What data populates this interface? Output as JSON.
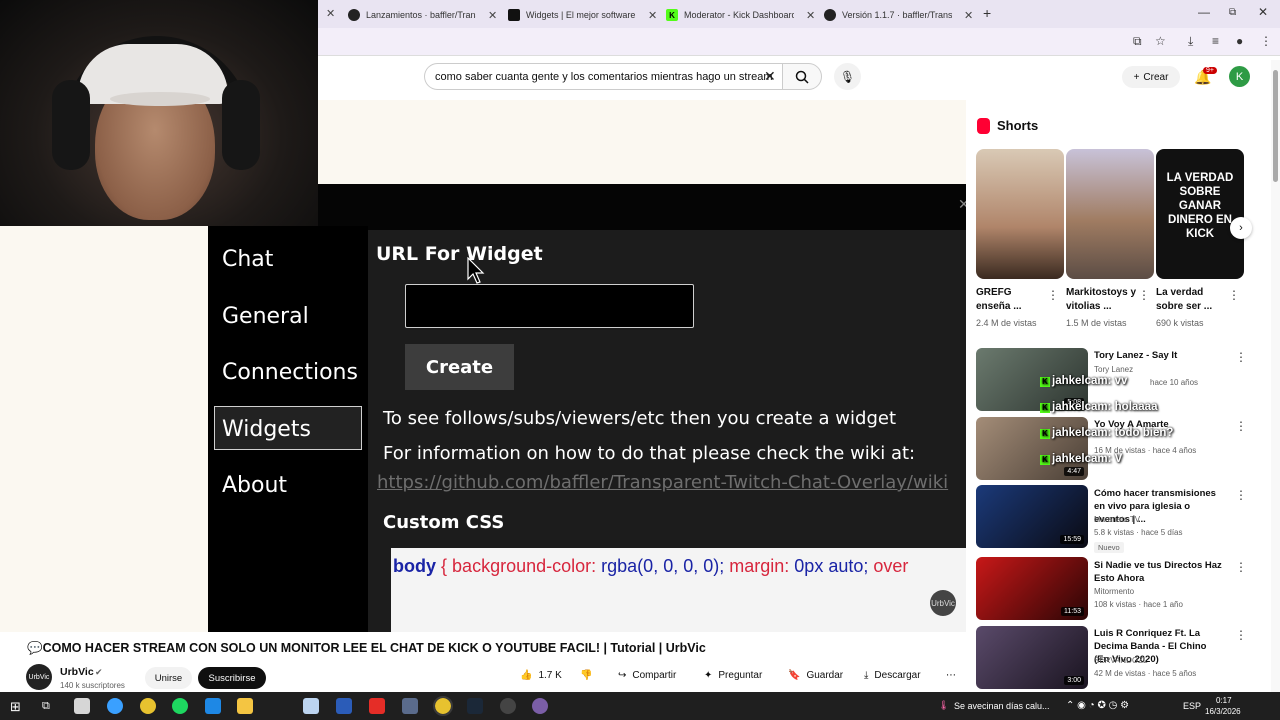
{
  "browser": {
    "tabs": [
      {
        "label": "Lanzamientos · baffler/Transpa",
        "icon": "github-icon"
      },
      {
        "label": "Widgets | El mejor software pa",
        "icon": "site-icon"
      },
      {
        "label": "Moderator - Kick Dashboard",
        "icon": "kick-icon"
      },
      {
        "label": "Versión 1.1.7 · baffler/Transpare",
        "icon": "github-icon"
      }
    ],
    "new_tab": "+",
    "minimize": "—",
    "restore": "⧉",
    "close": "✕"
  },
  "youtube": {
    "search_value": "como saber cuanta gente y los comentarios mientras hago un stream",
    "create_label": "Crear",
    "notif_badge": "9+",
    "avatar_letter": "K"
  },
  "video": {
    "nav": [
      "Chat",
      "General",
      "Connections",
      "Widgets",
      "About"
    ],
    "url_title": "URL For Widget",
    "create_button": "Create",
    "line1": "To see follows/subs/viewers/etc then you create a widget",
    "line2": "For information on how to do that please check the wiki at:",
    "link": "https://github.com/baffler/Transparent-Twitch-Chat-Overlay/wiki",
    "custom_css": "Custom CSS",
    "code": {
      "sel": "body",
      "brace": "{",
      "p1": "background-color:",
      "v1": "rgba(0, 0, 0, 0);",
      "p2": "margin:",
      "v2": "0px auto;",
      "p3": "over"
    },
    "watermark": "UrbVic",
    "title": "💬COMO HACER STREAM CON SOLO UN MONITOR LEE EL CHAT DE KICK O YOUTUBE FACIL! | Tutorial | UrbVic",
    "channel": "UrbVic",
    "subs": "140 k suscriptores",
    "join": "Unirse",
    "subscribe": "Suscribirse",
    "likes": "1.7 K",
    "share": "Compartir",
    "ask": "Preguntar",
    "save": "Guardar",
    "download": "Descargar"
  },
  "shorts": {
    "heading": "Shorts",
    "items": [
      {
        "title": "GREFG enseña ...",
        "views": "2.4 M de vistas"
      },
      {
        "title": "Markitostoys y vitolias ...",
        "views": "1.5 M de vistas"
      },
      {
        "title": "La verdad sobre ser ...",
        "views": "690 k vistas"
      }
    ],
    "short3_overlay": "LA VERDAD SOBRE GANAR DINERO EN KICK"
  },
  "recommended": [
    {
      "title": "Tory Lanez - Say It",
      "channel": "Tory Lanez",
      "meta": "hace 10 años",
      "duration": "5:08"
    },
    {
      "title": "Yo Voy A Amarte",
      "channel": "",
      "meta": "16 M de vistas · hace 4 años",
      "duration": "4:47"
    },
    {
      "title": "Cómo hacer transmisiones en vivo para iglesia o eventos | ...",
      "channel": "Maranata TV",
      "meta": "5.8 k vistas · hace 5 días",
      "duration": "15:59",
      "badge": "Nuevo"
    },
    {
      "title": "Si Nadie ve tus Directos Haz Esto Ahora",
      "channel": "Mitormento",
      "meta": "108 k vistas · hace 1 año",
      "duration": "11:53"
    },
    {
      "title": "Luis R Conriquez Ft. La Decima Banda - El Chino (En Vivo 2020)",
      "channel": "SERVANDOZL",
      "meta": "42 M de vistas · hace 5 años",
      "duration": "3:00"
    }
  ],
  "chat_overlay": [
    {
      "user": "jahkelcam",
      "msg": ": vv"
    },
    {
      "user": "jahkelcam",
      "msg": ": holaaaa"
    },
    {
      "user": "jahkelcam",
      "msg": ": todo bien?"
    },
    {
      "user": "jahkelcam",
      "msg": ": V"
    }
  ],
  "taskbar": {
    "weather": "Se avecinan días calu...",
    "lang": "ESP",
    "time": "0:17",
    "date": "16/3/2026"
  }
}
